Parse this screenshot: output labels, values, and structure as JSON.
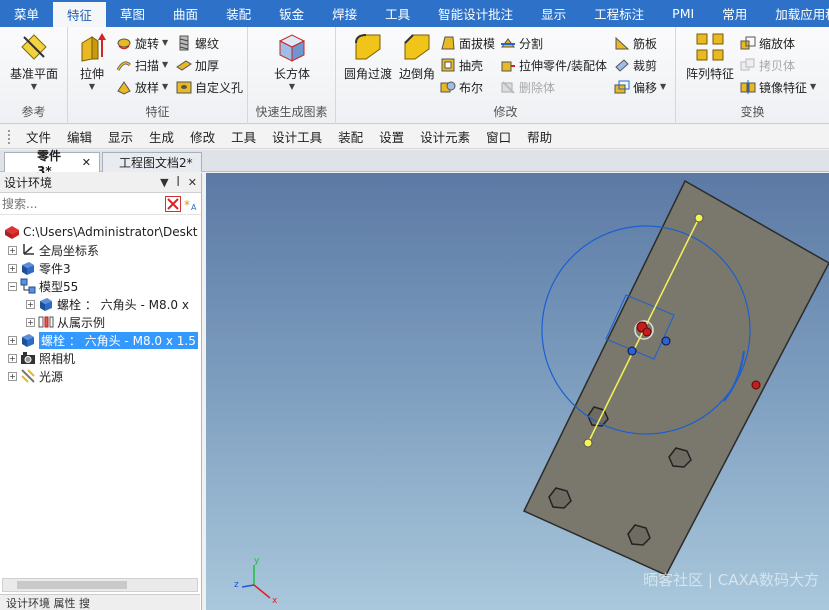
{
  "ribbon_tabs": [
    "菜单",
    "特征",
    "草图",
    "曲面",
    "装配",
    "钣金",
    "焊接",
    "工具",
    "智能设计批注",
    "显示",
    "工程标注",
    "PMI",
    "常用",
    "加载应用程"
  ],
  "active_tab": "特征",
  "groups": {
    "reference": {
      "label": "参考",
      "datum_plane": "基准平面"
    },
    "feature": {
      "label": "特征",
      "extrude": "拉伸",
      "revolve": "旋转",
      "sweep": "扫描",
      "loft": "放样",
      "thread": "螺纹",
      "thicken": "加厚",
      "custom_hole": "自定义孔"
    },
    "quick": {
      "label": "快速生成图素",
      "cuboid": "长方体"
    },
    "modify": {
      "label": "修改",
      "fillet": "圆角过渡",
      "chamfer": "边倒角",
      "draft": "面拔模",
      "shell": "抽壳",
      "boolean": "布尔",
      "split": "分割",
      "extrude_part": "拉伸零件/装配体",
      "delete_body": "删除体",
      "rib": "筋板",
      "trim": "裁剪",
      "offset": "偏移"
    },
    "transform": {
      "label": "变换",
      "pattern": "阵列特征",
      "scale": "缩放体",
      "copy": "拷贝体",
      "mirror": "镜像特征"
    }
  },
  "menubar": [
    "文件",
    "编辑",
    "显示",
    "生成",
    "修改",
    "工具",
    "设计工具",
    "装配",
    "设置",
    "设计元素",
    "窗口",
    "帮助"
  ],
  "doc_tabs": [
    {
      "label": "零件3*",
      "active": true
    },
    {
      "label": "工程图文档2*",
      "active": false
    }
  ],
  "panel": {
    "title": "设计环境",
    "search_placeholder": "搜索...",
    "tree": [
      {
        "label": "C:\\Users\\Administrator\\Deskt",
        "level": 0
      },
      {
        "label": "全局坐标系",
        "level": 1
      },
      {
        "label": "零件3",
        "level": 1
      },
      {
        "label": "模型55",
        "level": 1
      },
      {
        "label": "螺栓 ： 六角头 - M8.0 x",
        "level": 2
      },
      {
        "label": "从属示例",
        "level": 2
      },
      {
        "label": "螺栓 ： 六角头 - M8.0 x 1.5",
        "level": 1,
        "selected": true
      },
      {
        "label": "照相机",
        "level": 1
      },
      {
        "label": "光源",
        "level": 1
      }
    ],
    "bottom_tabs": "设计环境  属性  搜"
  },
  "viewport": {
    "watermark": "晒客社区 | CAXA数码大方",
    "axis_x": "x",
    "axis_y": "y",
    "axis_z": "z"
  }
}
